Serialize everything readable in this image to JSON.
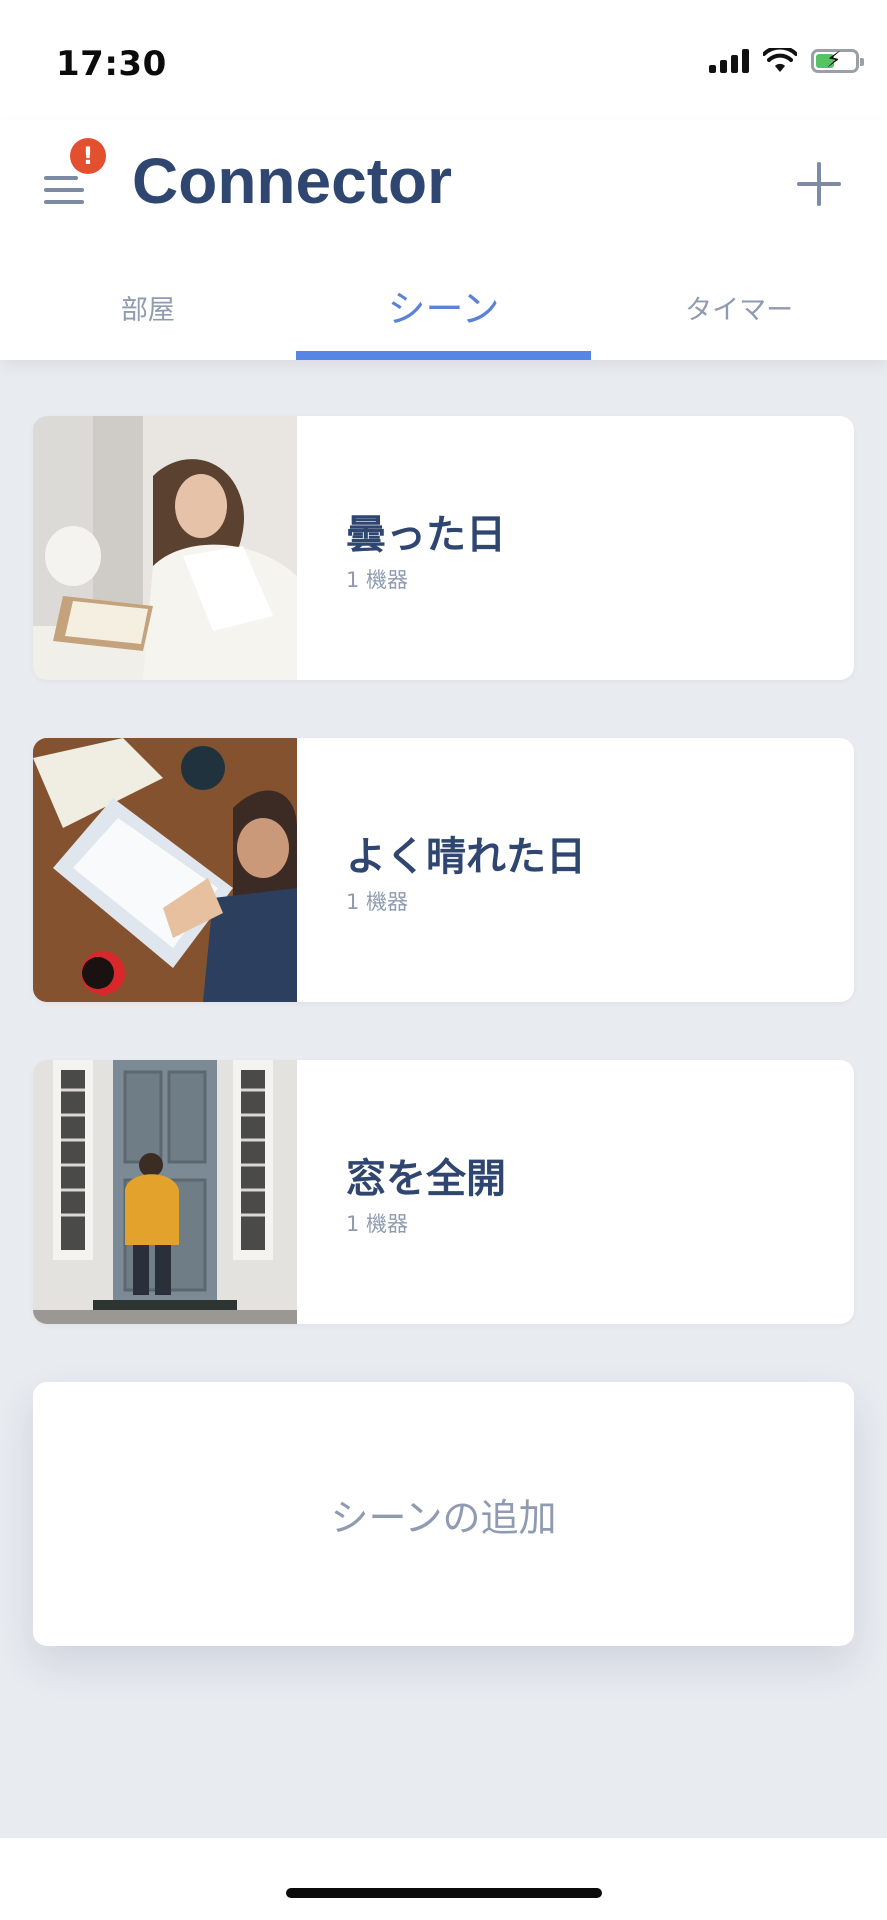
{
  "status": {
    "time": "17:30"
  },
  "header": {
    "title": "Connector",
    "badge": "!"
  },
  "tabs": [
    {
      "label": "部屋"
    },
    {
      "label": "シーン"
    },
    {
      "label": "タイマー"
    }
  ],
  "scenes": [
    {
      "name": "曇った日",
      "devices": "1 機器"
    },
    {
      "name": "よく晴れた日",
      "devices": "1 機器"
    },
    {
      "name": "窓を全開",
      "devices": "1 機器"
    }
  ],
  "add_scene": {
    "label": "シーンの追加"
  },
  "colors": {
    "brand": "#2f4670",
    "accent": "#5785e6",
    "badge": "#e2502f",
    "muted": "#8f9bb0",
    "background": "#e8ebf0"
  },
  "icons": [
    "menu-icon",
    "alert-badge-icon",
    "plus-icon",
    "signal-icon",
    "wifi-icon",
    "battery-charging-icon"
  ]
}
